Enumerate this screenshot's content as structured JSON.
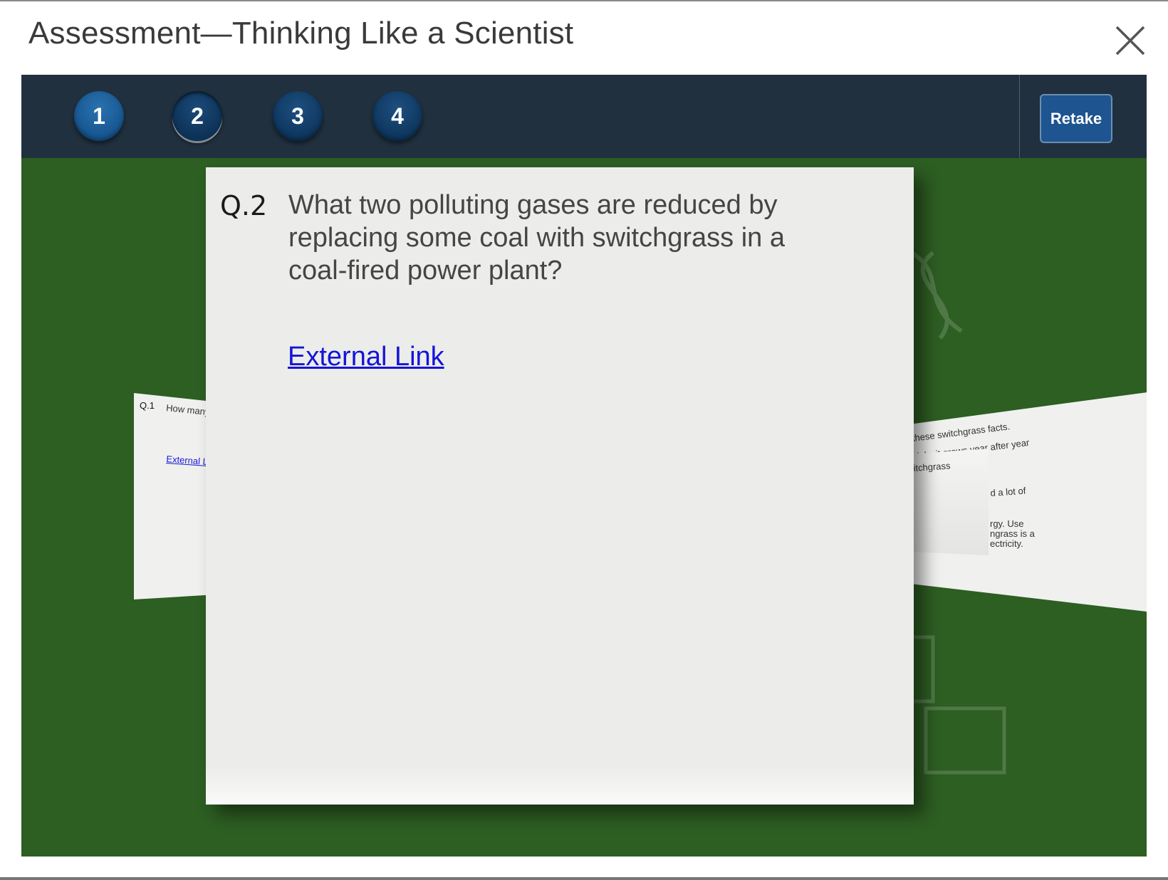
{
  "window": {
    "title": "Assessment—Thinking Like a Scientist",
    "close_icon": "close-icon"
  },
  "navigation": {
    "question_buttons": [
      {
        "label": "1",
        "state": "answered"
      },
      {
        "label": "2",
        "state": "current"
      },
      {
        "label": "3",
        "state": "unanswered"
      },
      {
        "label": "4",
        "state": "unanswered"
      }
    ],
    "retake_label": "Retake"
  },
  "current_question": {
    "number": "Q.2",
    "text": "What two polluting gases are reduced by replacing some coal with switchgrass in a coal-fired power plant?",
    "link_label": "External Link"
  },
  "previous_card": {
    "number": "Q.1",
    "text_fragment": "How many electricity burned for",
    "link_fragment": "External Li"
  },
  "next_card": {
    "lines": [
      "these switchgrass facts.",
      "nial—it grows year after year",
      "itchgrass",
      "d a lot of",
      "rgy. Use",
      "ngrass is a",
      "ectricity."
    ]
  },
  "colors": {
    "stage_green": "#2d5e22",
    "navbar": "#20303e",
    "accent_blue": "#1e5490",
    "link": "#1414d8"
  }
}
